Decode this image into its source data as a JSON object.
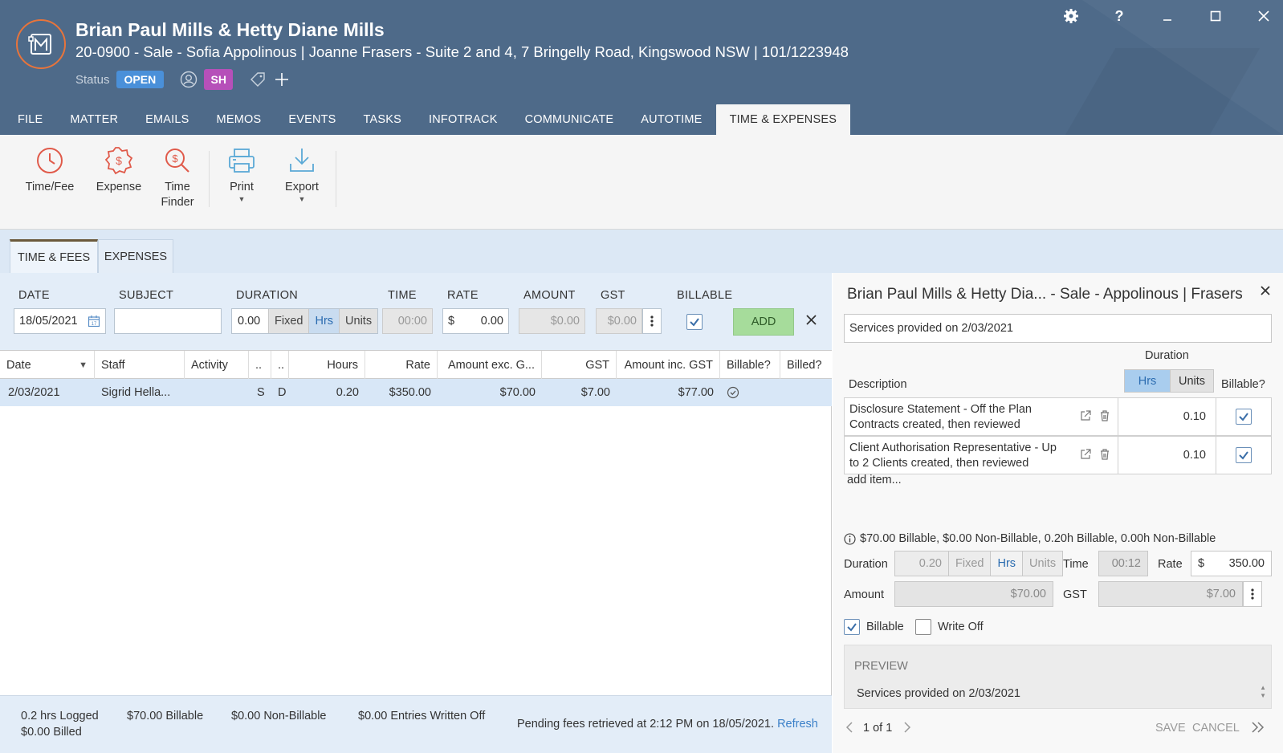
{
  "header": {
    "title": "Brian Paul Mills & Hetty Diane Mills",
    "subtitle": "20-0900 - Sale - Sofia Appolinous | Joanne Frasers - Suite 2 and 4, 7 Bringelly Road, Kingswood NSW | 101/1223948",
    "status_label": "Status",
    "status_value": "OPEN",
    "avatar_initials": "SH"
  },
  "window_controls": {
    "help": "?",
    "minimize": "_",
    "maximize": "☐",
    "close": "✕"
  },
  "tabs": [
    {
      "label": "FILE"
    },
    {
      "label": "MATTER"
    },
    {
      "label": "EMAILS"
    },
    {
      "label": "MEMOS"
    },
    {
      "label": "EVENTS"
    },
    {
      "label": "TASKS"
    },
    {
      "label": "INFOTRACK"
    },
    {
      "label": "COMMUNICATE"
    },
    {
      "label": "AUTOTIME"
    },
    {
      "label": "TIME & EXPENSES"
    }
  ],
  "ribbon": {
    "time_fee": "Time/Fee",
    "expense": "Expense",
    "time_finder_1": "Time",
    "time_finder_2": "Finder",
    "print": "Print",
    "export": "Export"
  },
  "subtabs": {
    "time_fees": "TIME & FEES",
    "expenses": "EXPENSES"
  },
  "entry": {
    "labels": {
      "date": "DATE",
      "subject": "SUBJECT",
      "duration": "DURATION",
      "time": "TIME",
      "rate": "RATE",
      "amount": "AMOUNT",
      "gst": "GST",
      "billable": "BILLABLE"
    },
    "date_value": "18/05/2021",
    "subject_value": "",
    "duration_value": "0.00",
    "fixed": "Fixed",
    "hrs": "Hrs",
    "units": "Units",
    "time_value": "00:00",
    "rate_currency": "$",
    "rate_value": "0.00",
    "amount_value": "$0.00",
    "gst_value": "$0.00",
    "add_label": "ADD",
    "clear_label": "✕"
  },
  "grid": {
    "columns": [
      "Date",
      "Staff",
      "Activity",
      "..",
      "..",
      "Hours",
      "Rate",
      "Amount exc. G...",
      "GST",
      "Amount inc. GST",
      "Billable?",
      "Billed?"
    ],
    "rows": [
      {
        "date": "2/03/2021",
        "staff": "Sigrid Hella...",
        "activity": "",
        "c1": "S",
        "c2": "D",
        "hours": "0.20",
        "rate": "$350.00",
        "amount_exc": "$70.00",
        "gst": "$7.00",
        "amount_inc": "$77.00"
      }
    ]
  },
  "footer": {
    "logged": "0.2 hrs Logged",
    "billed": "$0.00 Billed",
    "billable": "$70.00 Billable",
    "non_billable": "$0.00 Non-Billable",
    "written_off": "$0.00 Entries Written Off",
    "pending": "Pending fees retrieved at 2:12 PM on 18/05/2021.",
    "refresh": "Refresh"
  },
  "detail": {
    "title": "Brian Paul Mills & Hetty Dia... - Sale - Appolinous | Frasers",
    "close": "✕",
    "description_value": "Services provided on 2/03/2021",
    "duration_header": "Duration",
    "description_header": "Description",
    "hrs": "Hrs",
    "units": "Units",
    "billable_header": "Billable?",
    "items": [
      {
        "line1": "Disclosure Statement - Off the Plan",
        "line2": "Contracts created, then reviewed",
        "value": "0.10"
      },
      {
        "line1": "Client Authorisation Representative - Up",
        "line2": "to 2 Clients created, then reviewed",
        "value": "0.10"
      }
    ],
    "add_item": "add item...",
    "summary": "$70.00 Billable, $0.00 Non-Billable, 0.20h Billable, 0.00h Non-Billable",
    "duration_label": "Duration",
    "duration_value": "0.20",
    "fixed": "Fixed",
    "time_label": "Time",
    "time_value": "00:12",
    "rate_label": "Rate",
    "rate_currency": "$",
    "rate_value": "350.00",
    "amount_label": "Amount",
    "amount_value": "$70.00",
    "gst_label": "GST",
    "gst_value": "$7.00",
    "billable_label": "Billable",
    "write_off_label": "Write Off",
    "preview_label": "PREVIEW",
    "preview_text": "Services provided on 2/03/2021",
    "pager": "1 of 1",
    "save": "SAVE",
    "cancel": "CANCEL"
  },
  "colors": {
    "header_bg": "#4e6a89",
    "accent_orange": "#e8743b",
    "status_blue": "#4a90d9",
    "avatar_purple": "#b650b9",
    "add_green": "#a6dc9b",
    "icon_red": "#e05a4a",
    "icon_blue": "#5ba9d6"
  }
}
